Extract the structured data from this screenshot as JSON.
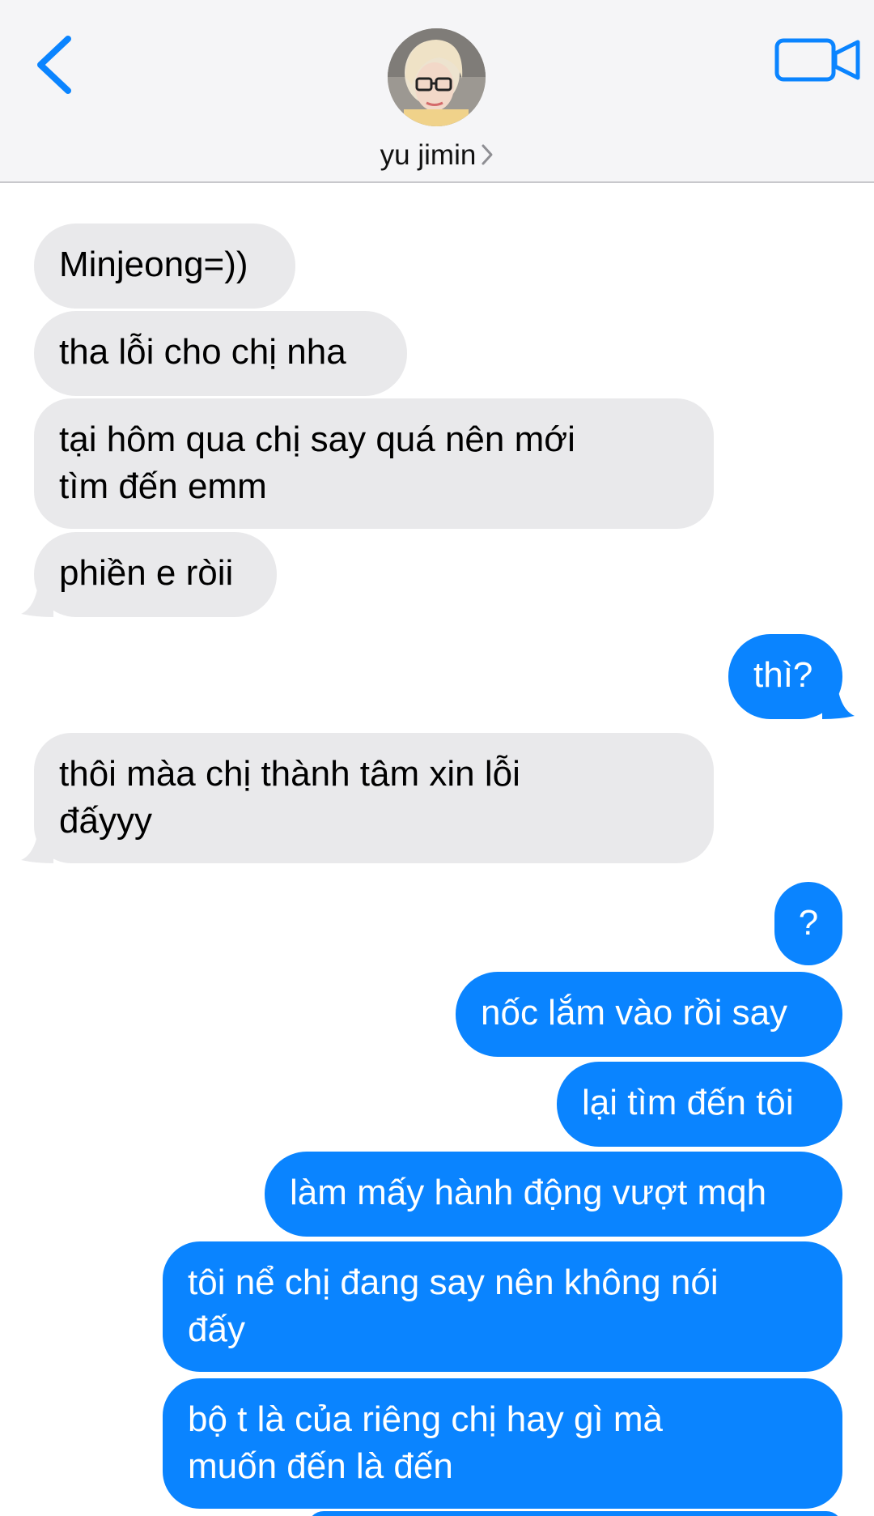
{
  "header": {
    "contact_name": "yu jimin",
    "back_icon": "chevron-left-icon",
    "video_icon": "video-camera-icon",
    "accent_color": "#0a84ff"
  },
  "messages": [
    {
      "from": "them",
      "text": "Minjeong=))"
    },
    {
      "from": "them",
      "text": "tha lỗi cho chị nha"
    },
    {
      "from": "them",
      "lines": [
        "tại hôm qua chị say quá nên mới",
        "tìm đến emm"
      ]
    },
    {
      "from": "them",
      "text": "phiền e ròii"
    },
    {
      "from": "me",
      "text": "thì?"
    },
    {
      "from": "them",
      "lines": [
        "thôi màa chị thành tâm xin lỗi",
        "đấyyy"
      ]
    },
    {
      "from": "me",
      "text": "?"
    },
    {
      "from": "me",
      "text": "nốc lắm vào rồi say"
    },
    {
      "from": "me",
      "text": "lại tìm đến tôi"
    },
    {
      "from": "me",
      "text": "làm mấy hành động vượt mqh"
    },
    {
      "from": "me",
      "lines": [
        "tôi nể chị đang say nên không nói",
        "đấy"
      ]
    },
    {
      "from": "me",
      "lines": [
        "bộ t là của riêng chị hay gì mà",
        "muốn đến là đến"
      ]
    }
  ]
}
